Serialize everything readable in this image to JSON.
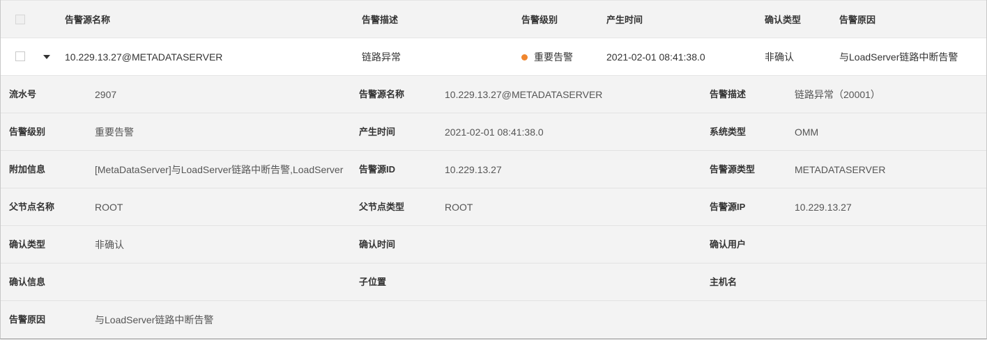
{
  "table": {
    "headers": {
      "source_name": "告警源名称",
      "description": "告警描述",
      "level": "告警级别",
      "time": "产生时间",
      "confirm_type": "确认类型",
      "reason": "告警原因"
    },
    "row": {
      "source_name": "10.229.13.27@METADATASERVER",
      "description": "链路异常",
      "level": "重要告警",
      "level_color": "#f0862e",
      "time": "2021-02-01 08:41:38.0",
      "confirm_type": "非确认",
      "reason": "与LoadServer链路中断告警"
    }
  },
  "detail": {
    "rows": [
      [
        {
          "label": "流水号",
          "value": "2907"
        },
        {
          "label": "告警源名称",
          "value": "10.229.13.27@METADATASERVER"
        },
        {
          "label": "告警描述",
          "value": "链路异常（20001）"
        }
      ],
      [
        {
          "label": "告警级别",
          "value": "重要告警"
        },
        {
          "label": "产生时间",
          "value": "2021-02-01 08:41:38.0"
        },
        {
          "label": "系统类型",
          "value": "OMM"
        }
      ],
      [
        {
          "label": "附加信息",
          "value": "[MetaDataServer]与LoadServer链路中断告警,LoadServer"
        },
        {
          "label": "告警源ID",
          "value": "10.229.13.27"
        },
        {
          "label": "告警源类型",
          "value": "METADATASERVER"
        }
      ],
      [
        {
          "label": "父节点名称",
          "value": "ROOT"
        },
        {
          "label": "父节点类型",
          "value": "ROOT"
        },
        {
          "label": "告警源IP",
          "value": "10.229.13.27"
        }
      ],
      [
        {
          "label": "确认类型",
          "value": "非确认"
        },
        {
          "label": "确认时间",
          "value": ""
        },
        {
          "label": "确认用户",
          "value": ""
        }
      ],
      [
        {
          "label": "确认信息",
          "value": ""
        },
        {
          "label": "子位置",
          "value": ""
        },
        {
          "label": "主机名",
          "value": ""
        }
      ],
      [
        {
          "label": "告警原因",
          "value": "与LoadServer链路中断告警"
        }
      ]
    ]
  },
  "icons": {
    "expand": "caret-down-icon",
    "select_all": "checkbox-icon",
    "row_select": "checkbox-icon",
    "severity": "status-dot-icon"
  }
}
